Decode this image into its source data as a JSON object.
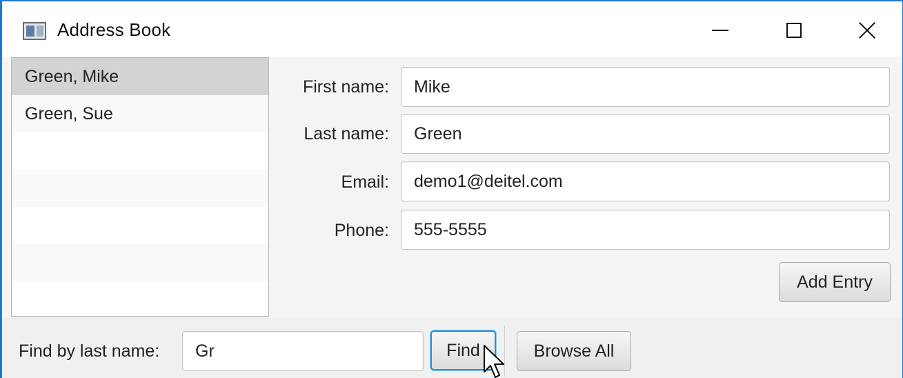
{
  "window": {
    "title": "Address Book",
    "icon": "app-window-icon",
    "controls": {
      "minimize": "minimize-icon",
      "maximize": "maximize-icon",
      "close": "close-icon"
    }
  },
  "contacts": {
    "items": [
      {
        "label": "Green, Mike",
        "selected": true
      },
      {
        "label": "Green, Sue",
        "selected": false
      }
    ]
  },
  "form": {
    "first_name": {
      "label": "First name:",
      "value": "Mike"
    },
    "last_name": {
      "label": "Last name:",
      "value": "Green"
    },
    "email": {
      "label": "Email:",
      "value": "demo1@deitel.com"
    },
    "phone": {
      "label": "Phone:",
      "value": "555-5555"
    },
    "add_entry_label": "Add Entry"
  },
  "search": {
    "label": "Find by last name:",
    "value": "Gr",
    "find_label": "Find",
    "browse_all_label": "Browse All"
  },
  "colors": {
    "window_border": "#1e78d4",
    "selection": "#d3d3d3",
    "focus_ring": "#1e8fe0"
  }
}
